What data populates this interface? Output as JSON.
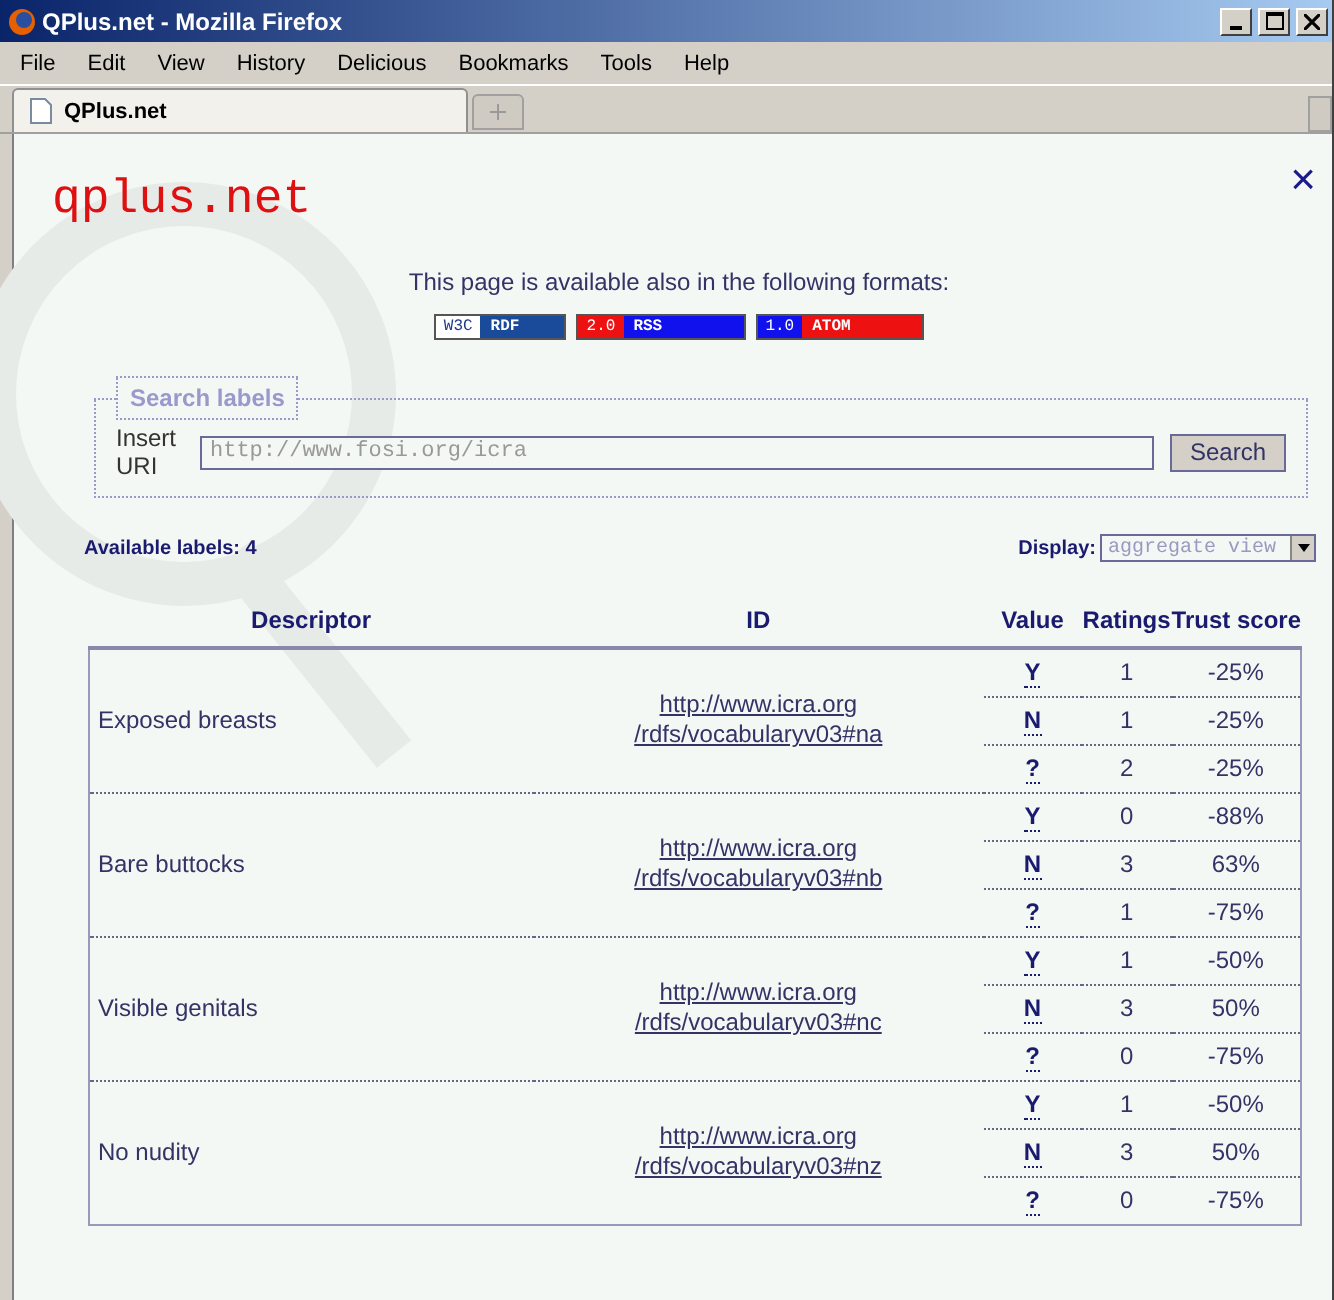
{
  "window": {
    "title": "QPlus.net - Mozilla Firefox"
  },
  "menu": [
    "File",
    "Edit",
    "View",
    "History",
    "Delicious",
    "Bookmarks",
    "Tools",
    "Help"
  ],
  "tabs": [
    {
      "label": "QPlus.net",
      "selected": true
    }
  ],
  "page": {
    "logo": "qplus.net",
    "close": "×",
    "formats_text": "This page is available also in the following formats:",
    "formats": [
      {
        "kind": "rdf",
        "badge": "W3C",
        "label": "RDF"
      },
      {
        "kind": "rss",
        "badge": "2.0",
        "label": "RSS"
      },
      {
        "kind": "atom",
        "badge": "1.0",
        "label": "ATOM"
      }
    ],
    "search": {
      "legend": "Search labels",
      "label": "Insert URI",
      "placeholder": "http://www.fosi.org/icra",
      "button": "Search"
    },
    "available": "Available labels: 4",
    "display": {
      "label": "Display:",
      "value": "aggregate view"
    },
    "table": {
      "columns": [
        "Descriptor",
        "ID",
        "Value",
        "Ratings",
        "Trust score"
      ],
      "rows": [
        {
          "descriptor": "Exposed breasts",
          "id": "http://www.icra.org\n/rdfs/vocabularyv03#na",
          "values": [
            {
              "value": "Y",
              "ratings": "1",
              "trust": "-25%"
            },
            {
              "value": "N",
              "ratings": "1",
              "trust": "-25%"
            },
            {
              "value": "?",
              "ratings": "2",
              "trust": "-25%"
            }
          ]
        },
        {
          "descriptor": "Bare buttocks",
          "id": "http://www.icra.org\n/rdfs/vocabularyv03#nb",
          "values": [
            {
              "value": "Y",
              "ratings": "0",
              "trust": "-88%"
            },
            {
              "value": "N",
              "ratings": "3",
              "trust": "63%"
            },
            {
              "value": "?",
              "ratings": "1",
              "trust": "-75%"
            }
          ]
        },
        {
          "descriptor": "Visible genitals",
          "id": "http://www.icra.org\n/rdfs/vocabularyv03#nc",
          "values": [
            {
              "value": "Y",
              "ratings": "1",
              "trust": "-50%"
            },
            {
              "value": "N",
              "ratings": "3",
              "trust": "50%"
            },
            {
              "value": "?",
              "ratings": "0",
              "trust": "-75%"
            }
          ]
        },
        {
          "descriptor": "No nudity",
          "id": "http://www.icra.org\n/rdfs/vocabularyv03#nz",
          "values": [
            {
              "value": "Y",
              "ratings": "1",
              "trust": "-50%"
            },
            {
              "value": "N",
              "ratings": "3",
              "trust": "50%"
            },
            {
              "value": "?",
              "ratings": "0",
              "trust": "-75%"
            }
          ]
        }
      ]
    }
  }
}
